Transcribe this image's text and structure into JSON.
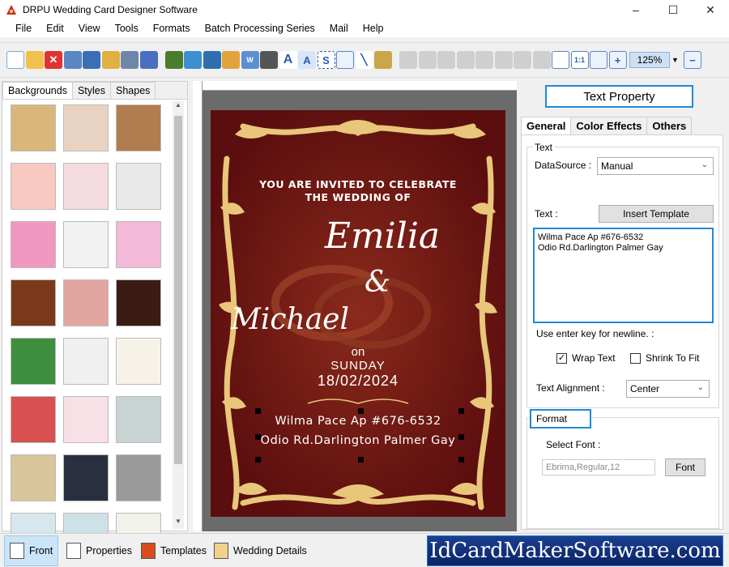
{
  "window": {
    "title": "DRPU Wedding Card Designer Software",
    "controls": [
      "–",
      "☐",
      "✕"
    ]
  },
  "menu": [
    "File",
    "Edit",
    "View",
    "Tools",
    "Formats",
    "Batch Processing Series",
    "Mail",
    "Help"
  ],
  "toolbar": {
    "zoom": "125%"
  },
  "left_panel": {
    "tabs": [
      "Backgrounds",
      "Styles",
      "Shapes"
    ],
    "active_tab": "Backgrounds",
    "thumb_colors": [
      "#d9b77a",
      "#e8d3c2",
      "#b07c50",
      "#f7c9c0",
      "#f4dbe0",
      "#e9e9e9",
      "#f297c2",
      "#f2f2f2",
      "#f2bad8",
      "#7a3a1a",
      "#e2a6a0",
      "#3b1b14",
      "#3f8e3e",
      "#f0f0f0",
      "#f7f2e8",
      "#d85050",
      "#f7e0e6",
      "#c9d3d4",
      "#d8c59a",
      "#2a2f3f",
      "#9a9a9a",
      "#d8e6ef",
      "#cfe1e8",
      "#f0f3ea"
    ]
  },
  "card": {
    "invite_line1": "YOU ARE INVITED TO CELEBRATE",
    "invite_line2": "THE WEDDING OF",
    "name1": "Emilia",
    "ampersand": "&",
    "name2": "Michael",
    "on": "on",
    "day": "SUNDAY",
    "date": "18/02/2024",
    "address_line1": "Wilma Pace Ap #676-6532",
    "address_line2": "Odio Rd.Darlington Palmer Gay"
  },
  "right_panel": {
    "title": "Text Property",
    "tabs": [
      "General",
      "Color Effects",
      "Others"
    ],
    "active_tab": "General",
    "text_group_label": "Text",
    "datasource_label": "DataSource :",
    "datasource_value": "Manual",
    "text_label": "Text :",
    "insert_template_label": "Insert Template",
    "text_value_line1": "Wilma Pace Ap #676-6532",
    "text_value_line2": "Odio Rd.Darlington Palmer Gay",
    "newline_hint": "Use enter key for newline. :",
    "wrap_text_label": "Wrap Text",
    "wrap_text_checked": true,
    "shrink_label": "Shrink To Fit",
    "shrink_checked": false,
    "alignment_label": "Text Alignment :",
    "alignment_value": "Center",
    "format_label": "Format",
    "select_font_label": "Select Font :",
    "font_value": "Ebrima,Regular,12",
    "font_button_label": "Font"
  },
  "bottom_tabs": [
    "Front",
    "Properties",
    "Templates",
    "Wedding Details"
  ],
  "active_bottom_tab": "Front",
  "brand": "IdCardMakerSoftware.com",
  "colors": {
    "card_bg": "#6e1212",
    "gold": "#e9c77a",
    "accent_blue": "#1e8ad6"
  }
}
